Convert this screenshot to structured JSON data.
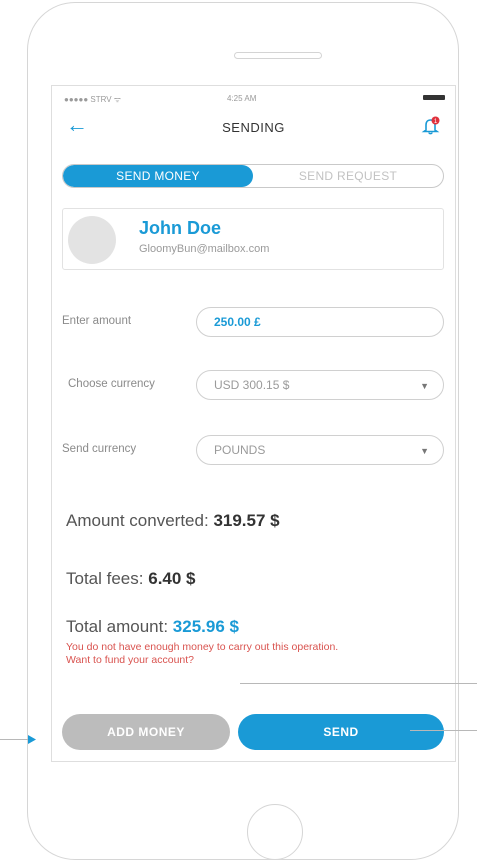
{
  "status_bar": {
    "carrier": "●●●●● STRV ᯤ",
    "time": "4:25 AM"
  },
  "nav": {
    "back_icon": "arrow-left-icon",
    "title": "SENDING",
    "notification_icon": "bell-icon",
    "notification_count": "1"
  },
  "tabs": [
    {
      "label": "SEND MONEY",
      "active": true
    },
    {
      "label": "SEND REQUEST",
      "active": false
    }
  ],
  "recipient": {
    "name": "John Doe",
    "email": "GloomyBun@mailbox.com"
  },
  "form": {
    "amount_label": "Enter amount",
    "amount_value": "250.00 £",
    "choose_currency_label": "Choose currency",
    "choose_currency_value": "USD 300.15 $",
    "send_currency_label": "Send currency",
    "send_currency_value": "POUNDS"
  },
  "summary": {
    "converted_label": "Amount converted:",
    "converted_value": "319.57 $",
    "fees_label": "Total fees:",
    "fees_value": "6.40 $",
    "total_label": "Total amount:",
    "total_value": "325.96 $"
  },
  "warning": {
    "line1": "You do not have enough money to carry out this operation.",
    "line2": "Want to fund your account?"
  },
  "buttons": {
    "add_money": "ADD MONEY",
    "send": "SEND"
  },
  "colors": {
    "accent": "#1a9ad6",
    "muted_button": "#bcbcbc",
    "warning": "#d9534f"
  }
}
